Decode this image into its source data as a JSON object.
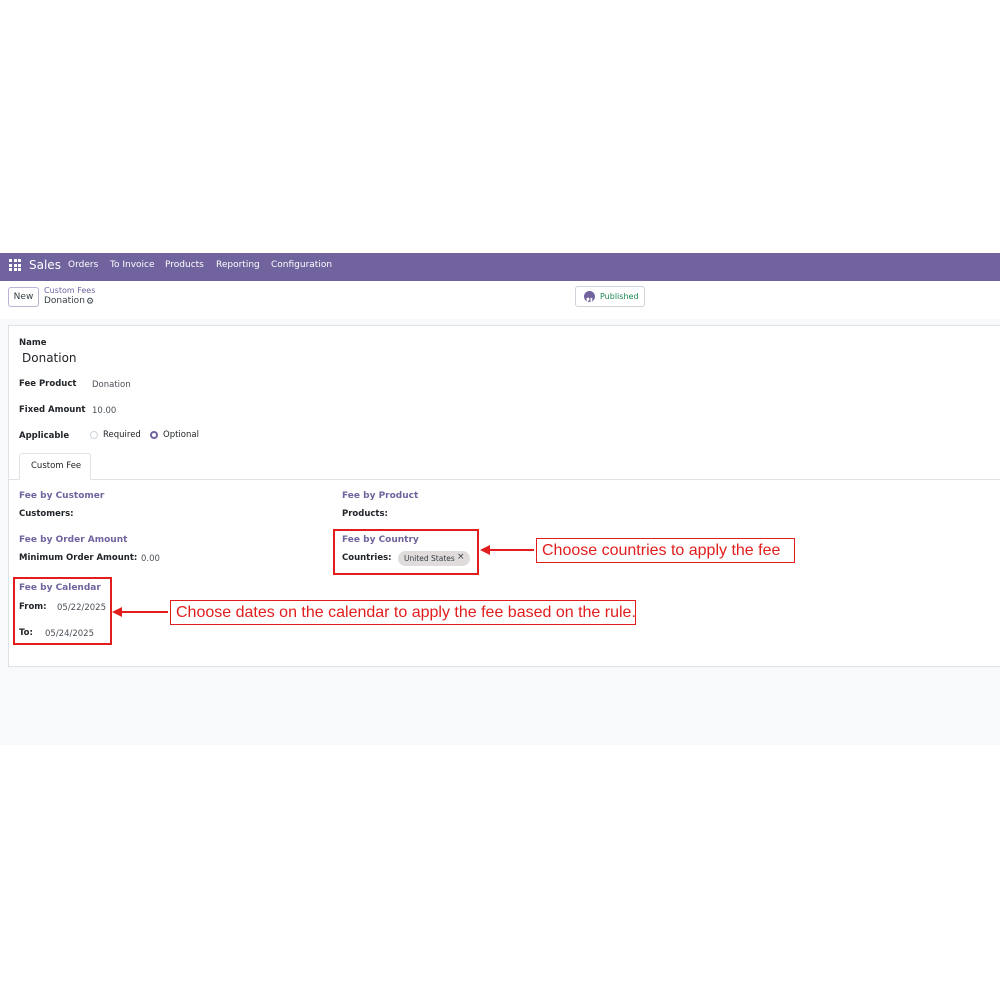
{
  "navbar": {
    "brand": "Sales",
    "menu": [
      "Orders",
      "To Invoice",
      "Products",
      "Reporting",
      "Configuration"
    ],
    "color": "#71639e"
  },
  "control_panel": {
    "new_label": "New",
    "breadcrumb_parent": "Custom Fees",
    "breadcrumb_current": "Donation",
    "published_label": "Published"
  },
  "form": {
    "name_label": "Name",
    "name_value": "Donation",
    "fee_product_label": "Fee Product",
    "fee_product_value": "Donation",
    "fixed_amount_label": "Fixed Amount",
    "fixed_amount_value": "10.00",
    "applicable_label": "Applicable",
    "applicable_options": [
      "Required",
      "Optional"
    ],
    "applicable_selected": "Optional",
    "tab_label": "Custom Fee",
    "fee_by_customer": "Fee by Customer",
    "customers_label": "Customers:",
    "fee_by_product": "Fee by Product",
    "products_label": "Products:",
    "fee_by_order_amount": "Fee by Order Amount",
    "min_order_label": "Minimum Order Amount:",
    "min_order_value": "0.00",
    "fee_by_country": "Fee by Country",
    "countries_label": "Countries:",
    "country_tag": "United States",
    "tag_remove": "×",
    "fee_by_calendar": "Fee by Calendar",
    "from_label": "From:",
    "from_value": "05/22/2025",
    "to_label": "To:",
    "to_value": "05/24/2025"
  },
  "annotations": {
    "country_note": "Choose countries to apply the fee",
    "calendar_note": "Choose dates on the calendar to apply the fee based on the rule.",
    "color": "#e11d1d"
  }
}
